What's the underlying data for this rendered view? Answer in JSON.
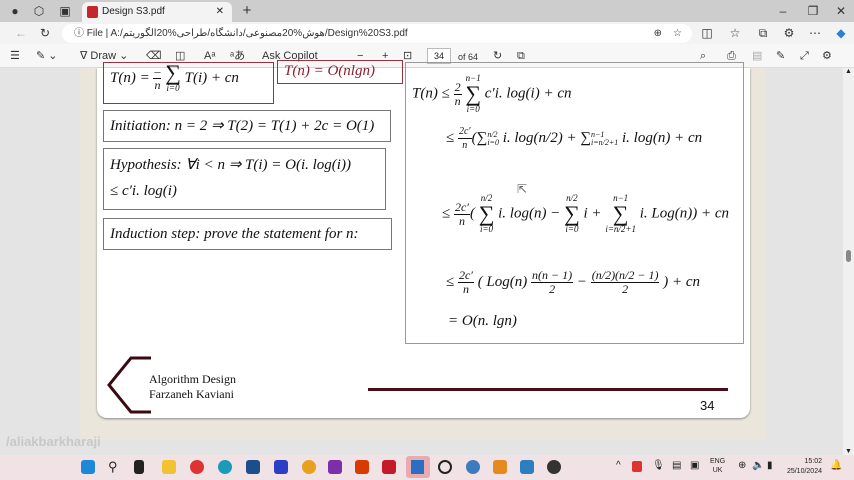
{
  "browser": {
    "tab_title": "Design S3.pdf",
    "url_prefix": "File",
    "url": "A:/هوش%20مصنوعی/دانشگاه/طراحی%20الگوریتم/Design%20S3.pdf"
  },
  "pdf_toolbar": {
    "draw_label": "Draw",
    "copilot_label": "Ask Copilot",
    "page_current": "34",
    "page_total": "of 64"
  },
  "slide": {
    "top_left": {
      "lhs": "T(n) = ",
      "num": "–",
      "den": "n",
      "sum_lower": "i=0",
      "rhs": "T(i) + cn"
    },
    "top_right": "T(n) = O(nlgn)",
    "initiation": "Initiation: n = 2 ⇒ T(2) = T(1) + 2c = O(1)",
    "hypothesis_1": "Hypothesis: ∀i < n ⇒ T(i) = O(i. log(i))",
    "hypothesis_2": "≤ c′i. log(i)",
    "induction": "Induction step: prove the statement for n:",
    "proof": {
      "l1": {
        "lhs": "T(n) ≤",
        "num": "2",
        "den": "n",
        "upper": "n−1",
        "lower": "i=0",
        "rhs": "c′i. log(i) + cn"
      },
      "l2": {
        "lhs": "≤",
        "num": "2c′",
        "den": "n",
        "a": "(∑",
        "a_sup": "n/2",
        "a_sub": "i=0",
        "b": "i. log(n/2) + ∑",
        "b_sup": "n−1",
        "b_sub": "i=n/2+1",
        "c": "i. log(n) + cn"
      },
      "l3": {
        "lhs": "≤",
        "num": "2c′",
        "den": "n",
        "s1_up": "n/2",
        "s1_lo": "i=0",
        "t1": "( ",
        "t2": "i. log(n) −",
        "s2_up": "n/2",
        "s2_lo": "i=0",
        "t3": "i +",
        "s3_up": "n−1",
        "s3_lo": "i=n/2+1",
        "t4": "i. Log(n)) + cn"
      },
      "l4": {
        "lhs": "≤",
        "num": "2c′",
        "den": "n",
        "t1": "( Log(n)",
        "f1_num": "n(n − 1)",
        "f1_den": "2",
        "minus": "−",
        "f2_num": "(n/2)(n/2 − 1)",
        "f2_den": "2",
        "t2": ") + cn"
      },
      "l5": "= O(n. lgn)"
    },
    "footer": {
      "line1": "Algorithm Design",
      "line2": "Farzaneh Kaviani",
      "page": "34"
    }
  },
  "watermark": "/aliakbarkharaji",
  "tray": {
    "lang1": "ENG",
    "lang2": "UK",
    "time": "15:02",
    "date": "25/10/2024"
  },
  "colors": {
    "accent": "#4a0e1a",
    "box_red": "#9b3040"
  }
}
